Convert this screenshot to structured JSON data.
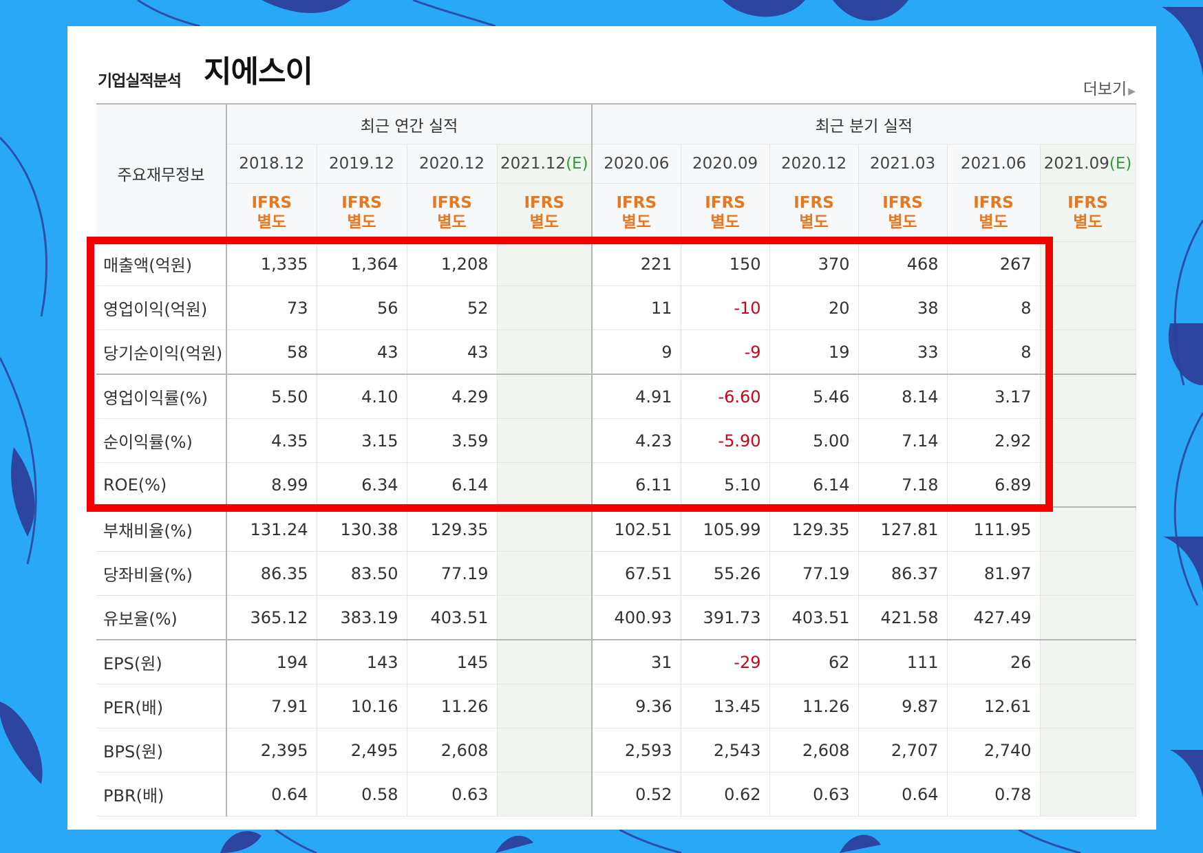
{
  "header": {
    "section_label": "기업실적분석",
    "company_name": "지에스이",
    "more_label": "더보기"
  },
  "table": {
    "corner_label": "주요재무정보",
    "group_annual": "최근 연간 실적",
    "group_quarter": "최근 분기 실적",
    "annual_periods": [
      "2018.12",
      "2019.12",
      "2020.12",
      "2021.12"
    ],
    "quarter_periods": [
      "2020.06",
      "2020.09",
      "2020.12",
      "2021.03",
      "2021.06",
      "2021.09"
    ],
    "estimate_mark": "(E)",
    "ifrs_line1": "IFRS",
    "ifrs_line2": "별도",
    "rows": [
      {
        "label": "매출액(억원)",
        "annual": [
          "1,335",
          "1,364",
          "1,208",
          ""
        ],
        "quarter": [
          "221",
          "150",
          "370",
          "468",
          "267",
          ""
        ]
      },
      {
        "label": "영업이익(억원)",
        "annual": [
          "73",
          "56",
          "52",
          ""
        ],
        "quarter": [
          "11",
          "-10",
          "20",
          "38",
          "8",
          ""
        ]
      },
      {
        "label": "당기순이익(억원)",
        "annual": [
          "58",
          "43",
          "43",
          ""
        ],
        "quarter": [
          "9",
          "-9",
          "19",
          "33",
          "8",
          ""
        ]
      },
      {
        "label": "영업이익률(%)",
        "annual": [
          "5.50",
          "4.10",
          "4.29",
          ""
        ],
        "quarter": [
          "4.91",
          "-6.60",
          "5.46",
          "8.14",
          "3.17",
          ""
        ]
      },
      {
        "label": "순이익률(%)",
        "annual": [
          "4.35",
          "3.15",
          "3.59",
          ""
        ],
        "quarter": [
          "4.23",
          "-5.90",
          "5.00",
          "7.14",
          "2.92",
          ""
        ]
      },
      {
        "label": "ROE(%)",
        "annual": [
          "8.99",
          "6.34",
          "6.14",
          ""
        ],
        "quarter": [
          "6.11",
          "5.10",
          "6.14",
          "7.18",
          "6.89",
          ""
        ]
      },
      {
        "label": "부채비율(%)",
        "annual": [
          "131.24",
          "130.38",
          "129.35",
          ""
        ],
        "quarter": [
          "102.51",
          "105.99",
          "129.35",
          "127.81",
          "111.95",
          ""
        ]
      },
      {
        "label": "당좌비율(%)",
        "annual": [
          "86.35",
          "83.50",
          "77.19",
          ""
        ],
        "quarter": [
          "67.51",
          "55.26",
          "77.19",
          "86.37",
          "81.97",
          ""
        ]
      },
      {
        "label": "유보율(%)",
        "annual": [
          "365.12",
          "383.19",
          "403.51",
          ""
        ],
        "quarter": [
          "400.93",
          "391.73",
          "403.51",
          "421.58",
          "427.49",
          ""
        ]
      },
      {
        "label": "EPS(원)",
        "annual": [
          "194",
          "143",
          "145",
          ""
        ],
        "quarter": [
          "31",
          "-29",
          "62",
          "111",
          "26",
          ""
        ]
      },
      {
        "label": "PER(배)",
        "annual": [
          "7.91",
          "10.16",
          "11.26",
          ""
        ],
        "quarter": [
          "9.36",
          "13.45",
          "11.26",
          "9.87",
          "12.61",
          ""
        ]
      },
      {
        "label": "BPS(원)",
        "annual": [
          "2,395",
          "2,495",
          "2,608",
          ""
        ],
        "quarter": [
          "2,593",
          "2,543",
          "2,608",
          "2,707",
          "2,740",
          ""
        ]
      },
      {
        "label": "PBR(배)",
        "annual": [
          "0.64",
          "0.58",
          "0.63",
          ""
        ],
        "quarter": [
          "0.52",
          "0.62",
          "0.63",
          "0.64",
          "0.78",
          ""
        ]
      }
    ]
  },
  "colors": {
    "background": "#29a8f5",
    "leaf": "#2d3f9c",
    "highlight_border": "#f20000",
    "ifrs_text": "#e8771e",
    "negative_text": "#d0021b",
    "estimate_mark": "#2d9b3a"
  }
}
